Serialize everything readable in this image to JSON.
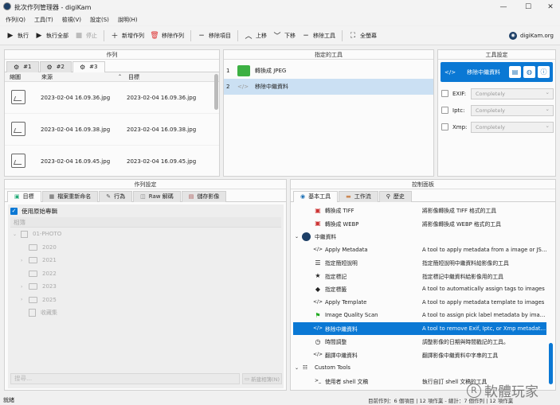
{
  "window": {
    "title": "批次作列管理器 - digiKam",
    "min": "—",
    "max": "☐",
    "close": "✕"
  },
  "menu": [
    "作列(Q)",
    "工具(T)",
    "檢視(V)",
    "設定(S)",
    "說明(H)"
  ],
  "toolbar": {
    "run": "執行",
    "run_all": "執行全部",
    "stop": "停止",
    "new_queue": "新增作列",
    "remove_queue": "移除作列",
    "remove_item": "移除項目",
    "up": "上移",
    "down": "下移",
    "remove_tool": "移除工具",
    "fullscreen": "全螢幕",
    "brand": "digiKam.org"
  },
  "queues": {
    "header": "作列",
    "tabs": [
      "#1",
      "#2",
      "#3"
    ],
    "columns": [
      "縮圖",
      "來源",
      "目標"
    ],
    "rows": [
      {
        "source": "2023-02-04 16.09.36.jpg",
        "target": "2023-02-04 16.09.36.jpg"
      },
      {
        "source": "2023-02-04 16.09.38.jpg",
        "target": "2023-02-04 16.09.38.jpg"
      },
      {
        "source": "2023-02-04 16.09.45.jpg",
        "target": "2023-02-04 16.09.45.jpg"
      }
    ]
  },
  "assigned": {
    "header": "指定的工具",
    "rows": [
      {
        "num": "1",
        "label": "轉換成 JPEG"
      },
      {
        "num": "2",
        "label": "移除中繼資料"
      }
    ]
  },
  "tool_settings": {
    "header": "工具設定",
    "tool_name": "移除中繼資料",
    "rows": [
      {
        "label": "EXIF:",
        "value": "Completely"
      },
      {
        "label": "Iptc:",
        "value": "Completely"
      },
      {
        "label": "Xmp:",
        "value": "Completely"
      }
    ]
  },
  "queue_settings": {
    "header": "作列設定",
    "tabs": [
      "目標",
      "檔案重新命名",
      "行為",
      "Raw 解碼",
      "儲存影像"
    ],
    "use_original": "使用原始專輯",
    "album_header": "相簿",
    "root": "01-PHOTO",
    "years": [
      "2020",
      "2021",
      "2022",
      "2023",
      "2025"
    ],
    "other": "收藏集",
    "search_placeholder": "搜尋...",
    "new_album": "新建相簿(N)"
  },
  "control_panel": {
    "header": "控制面板",
    "tabs": [
      "基本工具",
      "工作流",
      "歷史"
    ],
    "rows": [
      {
        "name": "轉換成 TIFF",
        "desc": "將影像轉換成 TIFF 格式的工具",
        "icon": "▣"
      },
      {
        "name": "轉換成 WEBP",
        "desc": "將影像轉換成 WEBP 格式的工具",
        "icon": "▣"
      },
      {
        "name": "中繼資料",
        "desc": "",
        "icon": "</>",
        "group": true
      },
      {
        "name": "Apply Metadata",
        "desc": "A tool to apply metadata from a image or JSON f...",
        "icon": "</>"
      },
      {
        "name": "指定簡短說明",
        "desc": "指定簡短說明中繼資料給影像的工具",
        "icon": "☰"
      },
      {
        "name": "指定標記",
        "desc": "指定標記中繼資料給影像用的工具",
        "icon": "★"
      },
      {
        "name": "指定標籤",
        "desc": "A tool to automatically assign tags to images",
        "icon": "◆"
      },
      {
        "name": "Apply Template",
        "desc": "A tool to apply metadata template to images",
        "icon": "</>"
      },
      {
        "name": "Image Quality Scan",
        "desc": "A tool to assign pick label metadata by image qu...",
        "icon": "⚑"
      },
      {
        "name": "移除中繼資料",
        "desc": "A tool to remove Exif, Iptc, or Xmp metadata fro...",
        "icon": "</>",
        "sel": true
      },
      {
        "name": "時間調整",
        "desc": "調整影像的日期與時間戳記的工具。",
        "icon": "◷"
      },
      {
        "name": "翻譯中繼資料",
        "desc": "翻譯影像中繼資料中字串的工具",
        "icon": "</>"
      },
      {
        "name": "Custom Tools",
        "desc": "",
        "icon": "☷",
        "group": true
      },
      {
        "name": "使用者 shell 文稿",
        "desc": "執行自訂 shell 文稿的工具",
        "icon": ">_"
      }
    ]
  },
  "status": {
    "left": "就緒",
    "right": "目前作列：6 個項目 | 12 項作業 - 總計：7 個作列 | 12 項作業"
  },
  "watermark": "軟體玩家",
  "colors": {
    "accent": "#0a78d4",
    "selection": "#cbe0f3"
  }
}
